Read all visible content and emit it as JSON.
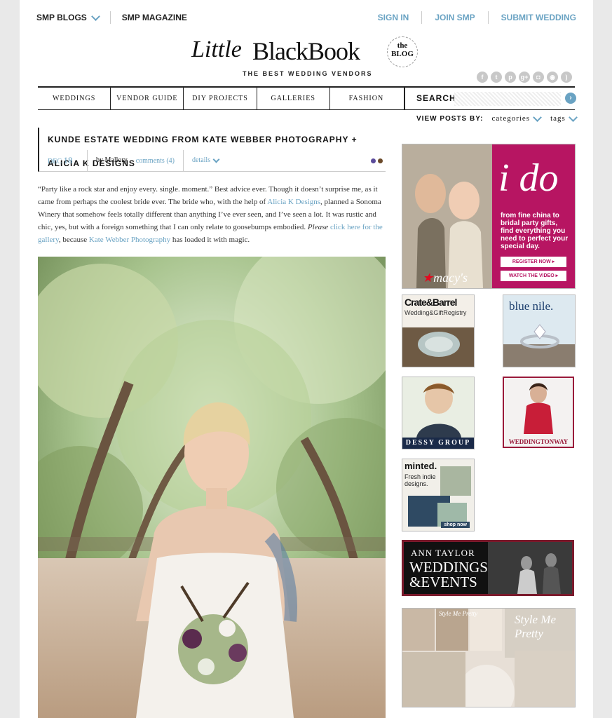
{
  "topnav": {
    "left": [
      "SMP BLOGS",
      "SMP MAGAZINE"
    ],
    "right": [
      "SIGN IN",
      "JOIN SMP",
      "SUBMIT WEDDING"
    ]
  },
  "logo": {
    "little": "Little",
    "blackbook": "BlackBook",
    "the": "the",
    "blog": "BLOG",
    "tagline": "THE BEST WEDDING VENDORS"
  },
  "social_icons": [
    "facebook-icon",
    "twitter-icon",
    "pinterest-icon",
    "google-plus-icon",
    "instagram-icon",
    "camera-icon",
    "rss-icon"
  ],
  "mainnav": [
    "WEDDINGS",
    "VENDOR GUIDE",
    "DIY PROJECTS",
    "GALLERIES",
    "FASHION"
  ],
  "search": {
    "label": "SEARCH",
    "placeholder": ""
  },
  "viewby": {
    "label": "VIEW POSTS BY:",
    "categories": "categories",
    "tags": "tags"
  },
  "post": {
    "title": "KUNDE ESTATE WEDDING FROM KATE WEBBER PHOTOGRAPHY + ALICIA K DESIGNS",
    "month": "DEC",
    "day": "18",
    "author": "by Mallory",
    "comments": "comments (4)",
    "details": "details",
    "dots": [
      "#5b4b9a",
      "#6b4a2a"
    ],
    "p_part1": "“Party like a rock star and enjoy every. single. moment.” Best advice ever. Though it doesn’t surprise me, as it came from perhaps the coolest bride ever. The bride who, with the help of ",
    "link1": "Alicia K Designs",
    "p_part2": ", planned a Sonoma Winery that somehow feels totally different than anything I’ve ever seen, and I’ve seen a lot. It was rustic and chic, yes, but with a foreign something that I can only relate to goosebumps embodied. ",
    "please": "Please",
    "link2": "click here for the gallery",
    "p_part3": ", because ",
    "link3": "Kate Webber Photography",
    "p_part4": " has loaded it with magic."
  },
  "ads": {
    "macys": {
      "ido": "i do",
      "copy": "from fine china to bridal party gifts, find everything you need to perfect your special day.",
      "btn1": "REGISTER NOW ▸",
      "btn2": "WATCH THE VIDEO ▸",
      "brand": "macy's"
    },
    "crate": {
      "name": "Crate&Barrel",
      "sub": "Wedding&GiftRegistry"
    },
    "bluenile": {
      "name": "blue nile."
    },
    "dessy": {
      "name": "DESSY GROUP"
    },
    "weddington": {
      "name": "WEDDINGTONWAY"
    },
    "minted": {
      "name": "minted.",
      "copy": "Fresh indie designs.",
      "shop": "shop now"
    },
    "anntaylor": {
      "l1": "ANN TAYLOR",
      "l2": "WEDDINGS",
      "l3": "&EVENTS"
    },
    "style": {
      "a": "Style Me Pretty",
      "b": "Style Me Pretty"
    }
  }
}
